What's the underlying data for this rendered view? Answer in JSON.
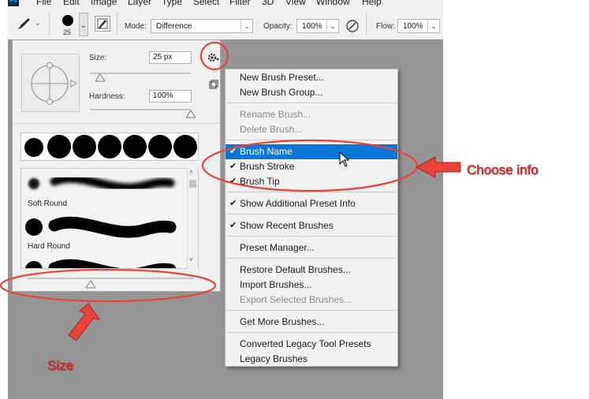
{
  "menubar": {
    "logo": "Ps",
    "items": [
      "File",
      "Edit",
      "Image",
      "Layer",
      "Type",
      "Select",
      "Filter",
      "3D",
      "View",
      "Window",
      "Help"
    ]
  },
  "options": {
    "brush_size": "25",
    "mode_label": "Mode:",
    "mode_value": "Difference",
    "opacity_label": "Opacity:",
    "opacity_value": "100%",
    "flow_label": "Flow:",
    "flow_value": "100%"
  },
  "panel": {
    "size_label": "Size:",
    "size_value": "25 px",
    "size_slider_fraction": 0.1,
    "hardness_label": "Hardness:",
    "hardness_value": "100%",
    "hardness_slider_fraction": 1.0,
    "preset_size_slider_fraction": 0.38,
    "brushes": [
      {
        "name": "Soft Round"
      },
      {
        "name": "Hard Round"
      },
      {
        "name": ""
      }
    ]
  },
  "menu": {
    "items": [
      {
        "label": "New Brush Preset...",
        "enabled": true,
        "checked": false
      },
      {
        "label": "New Brush Group...",
        "enabled": true,
        "checked": false
      },
      {
        "label": "Rename Brush...",
        "enabled": false,
        "checked": false
      },
      {
        "label": "Delete Brush...",
        "enabled": false,
        "checked": false
      },
      {
        "label": "Brush Name",
        "enabled": true,
        "checked": true,
        "highlighted": true
      },
      {
        "label": "Brush Stroke",
        "enabled": true,
        "checked": true
      },
      {
        "label": "Brush Tip",
        "enabled": true,
        "checked": true
      },
      {
        "label": "Show Additional Preset Info",
        "enabled": true,
        "checked": true
      },
      {
        "label": "Show Recent Brushes",
        "enabled": true,
        "checked": true
      },
      {
        "label": "Preset Manager...",
        "enabled": true,
        "checked": false
      },
      {
        "label": "Restore Default Brushes...",
        "enabled": true,
        "checked": false
      },
      {
        "label": "Import Brushes...",
        "enabled": true,
        "checked": false
      },
      {
        "label": "Export Selected Brushes...",
        "enabled": false,
        "checked": false
      },
      {
        "label": "Get More Brushes...",
        "enabled": true,
        "checked": false
      },
      {
        "label": "Converted Legacy Tool Presets",
        "enabled": true,
        "checked": false
      },
      {
        "label": "Legacy Brushes",
        "enabled": true,
        "checked": false
      }
    ]
  },
  "annotations": {
    "choose_info": "Choose info",
    "size": "Size",
    "color": "#e8433a"
  },
  "colors": {
    "menu_highlight": "#0b78d7",
    "canvas": "#959595"
  }
}
